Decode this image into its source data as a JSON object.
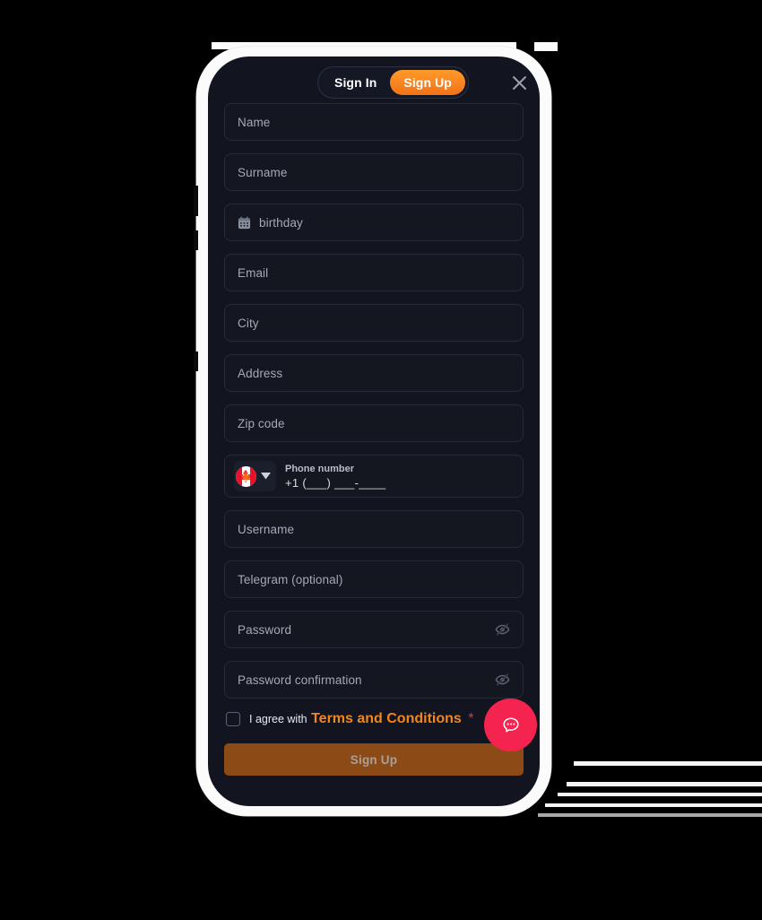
{
  "header": {
    "tabs": [
      {
        "label": "Sign In",
        "active": false
      },
      {
        "label": "Sign Up",
        "active": true
      }
    ],
    "close_label": "Close"
  },
  "form": {
    "fields": [
      {
        "name": "name",
        "placeholder": "Name",
        "icon": null,
        "trailing": null
      },
      {
        "name": "surname",
        "placeholder": "Surname",
        "icon": null,
        "trailing": null
      },
      {
        "name": "birthday",
        "placeholder": "birthday",
        "icon": "calendar-icon",
        "trailing": null
      },
      {
        "name": "email",
        "placeholder": "Email",
        "icon": null,
        "trailing": null
      },
      {
        "name": "city",
        "placeholder": "City",
        "icon": null,
        "trailing": null
      },
      {
        "name": "address",
        "placeholder": "Address",
        "icon": null,
        "trailing": null
      },
      {
        "name": "zip-code",
        "placeholder": "Zip code",
        "icon": null,
        "trailing": null
      },
      {
        "name": "username",
        "placeholder": "Username",
        "icon": null,
        "trailing": null
      },
      {
        "name": "telegram",
        "placeholder": "Telegram (optional)",
        "icon": null,
        "trailing": null
      },
      {
        "name": "password",
        "placeholder": "Password",
        "icon": null,
        "trailing": "eye-off-icon"
      },
      {
        "name": "password-confirmation",
        "placeholder": "Password confirmation",
        "icon": null,
        "trailing": "eye-off-icon"
      }
    ],
    "phone": {
      "country_flag": "canada-flag",
      "country_code": "+1",
      "label": "Phone number",
      "value": "+1 (___) ___-____"
    },
    "terms": {
      "prefix": "I agree with",
      "link": "Terms and Conditions",
      "required_marker": "*",
      "checked": false
    },
    "submit_label": "Sign Up"
  },
  "widgets": {
    "chat_label": "Chat support"
  },
  "colors": {
    "accent_orange": "#f2721a",
    "accent_orange_light": "#ff9a2a",
    "terms_link": "#f2861a",
    "required_red": "#e03a2f",
    "chat_fab": "#f4244f",
    "submit_disabled": "#8c4a16",
    "screen_bg": "#121520",
    "field_bg": "#14171f",
    "field_border": "#262b38",
    "placeholder": "#a4a9b8",
    "device_frame": "#fbfbfb"
  }
}
